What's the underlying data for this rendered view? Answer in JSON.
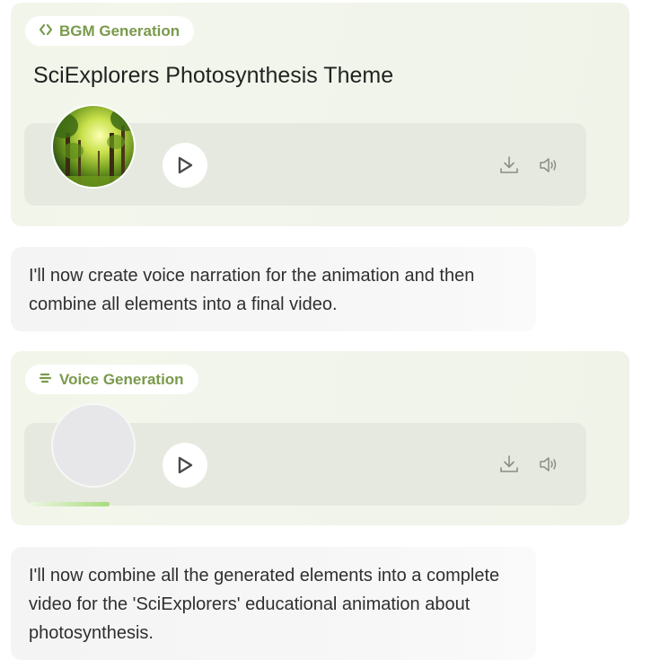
{
  "bgm": {
    "badge": "BGM Generation",
    "title": "SciExplorers Photosynthesis Theme",
    "cover_icon": "forest-cover-image",
    "play_icon": "play-icon",
    "download_icon": "download-icon",
    "volume_icon": "volume-icon"
  },
  "message1": "I'll now create voice narration for the animation and then combine all elements into a final video.",
  "voice": {
    "badge": "Voice Generation",
    "cover_icon": "placeholder-avatar",
    "play_icon": "play-icon",
    "download_icon": "download-icon",
    "volume_icon": "volume-icon",
    "loading_progress": 0.15
  },
  "message2": "I'll now combine all the generated elements into a complete video for the 'SciExplorers' educational animation about photosynthesis.",
  "colors": {
    "accent": "#7a9a4b",
    "card_bg": "#f2f6ea",
    "player_bg": "#e6e9df",
    "progress": "#a7dc7e"
  }
}
